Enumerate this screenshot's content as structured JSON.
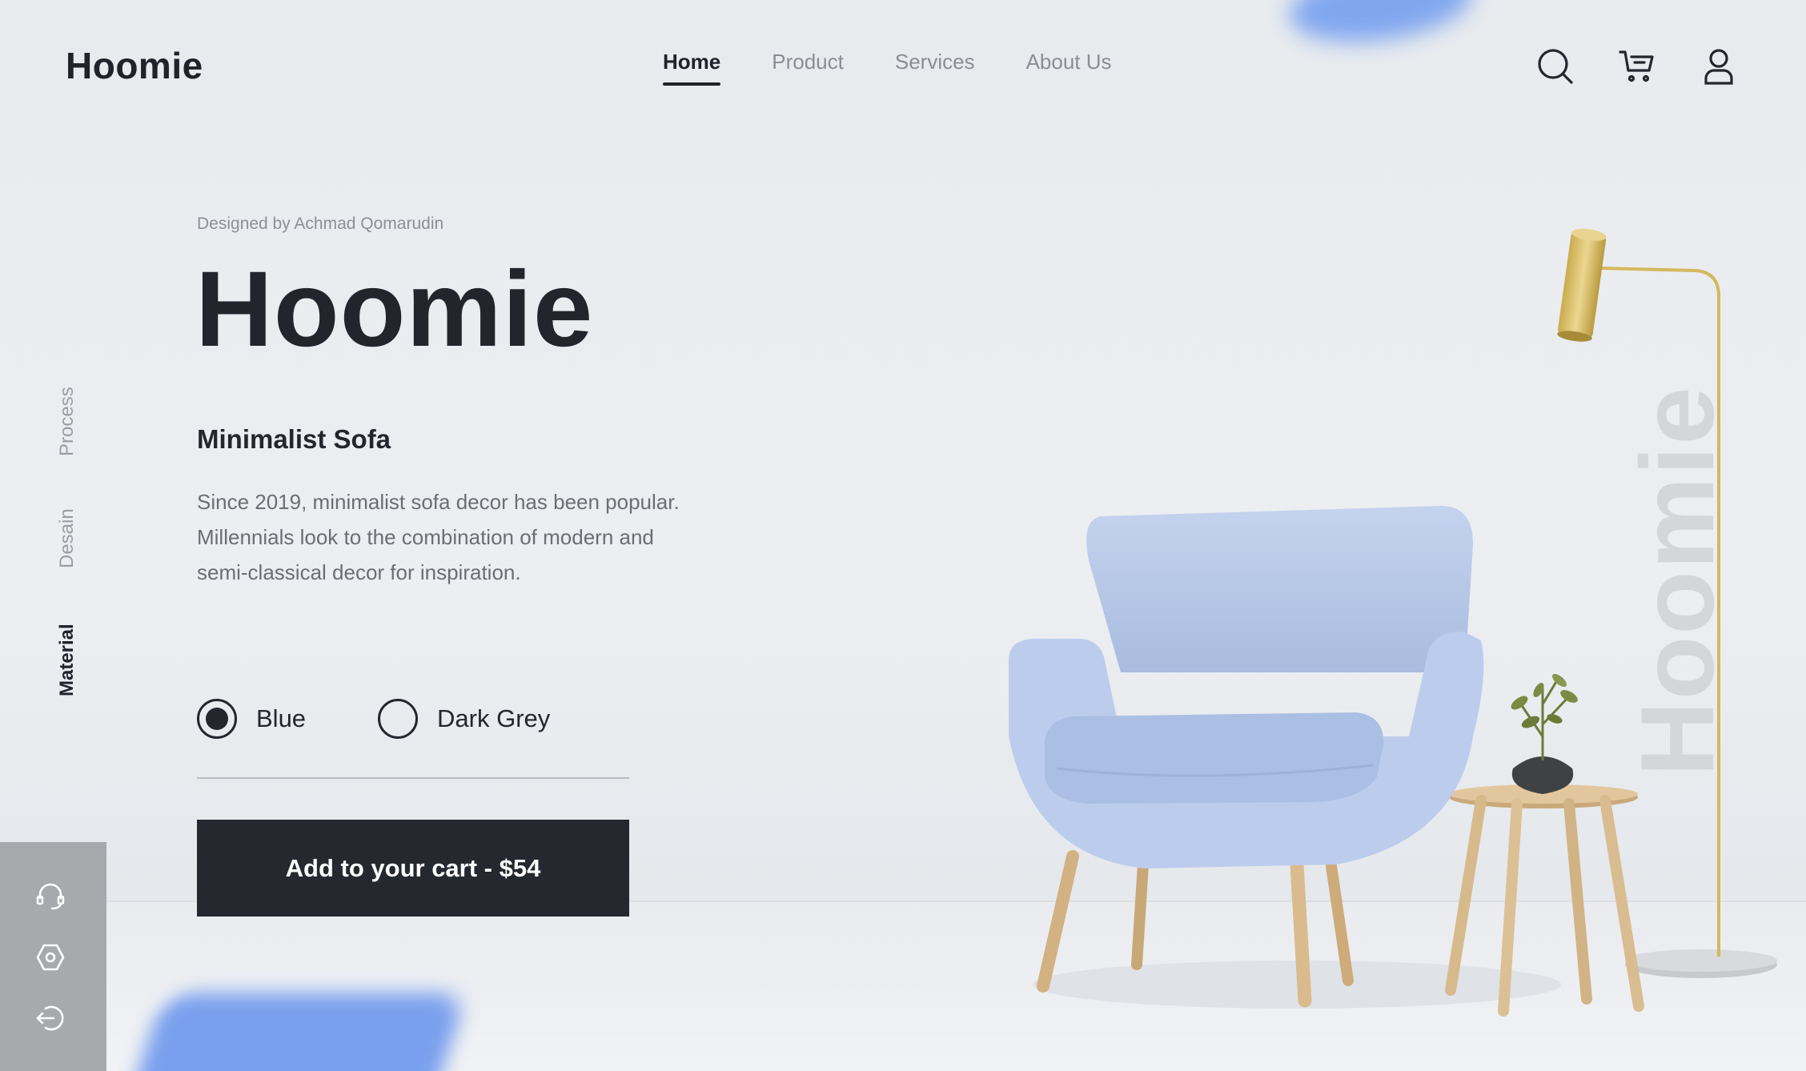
{
  "brand": {
    "logo": "Hoomie"
  },
  "nav": {
    "items": [
      {
        "label": "Home",
        "active": true
      },
      {
        "label": "Product",
        "active": false
      },
      {
        "label": "Services",
        "active": false
      },
      {
        "label": "About Us",
        "active": false
      }
    ]
  },
  "header_icons": [
    "search-icon",
    "cart-icon",
    "user-icon"
  ],
  "vertical_tabs": [
    {
      "label": "Process",
      "active": false
    },
    {
      "label": "Desain",
      "active": false
    },
    {
      "label": "Material",
      "active": true
    }
  ],
  "sidebar_icons": [
    "headset-icon",
    "settings-icon",
    "logout-icon"
  ],
  "hero": {
    "designed_by": "Designed by Achmad Qomarudin",
    "title": "Hoomie",
    "subtitle": "Minimalist Sofa",
    "description": [
      "Since 2019, minimalist sofa decor has been popular.",
      "Millennials look to the combination of modern and",
      "semi-classical decor for inspiration."
    ]
  },
  "color_options": [
    {
      "label": "Blue",
      "selected": true
    },
    {
      "label": "Dark Grey",
      "selected": false
    }
  ],
  "cart_button": {
    "label": "Add to your cart - $54"
  },
  "watermark": "Hoomie",
  "colors": {
    "dark": "#262830",
    "accent_blue": "#6e9bf0",
    "chair_blue": "#b7c8e6",
    "wood": "#d8b98b",
    "lamp_gold": "#d6bb5f"
  }
}
